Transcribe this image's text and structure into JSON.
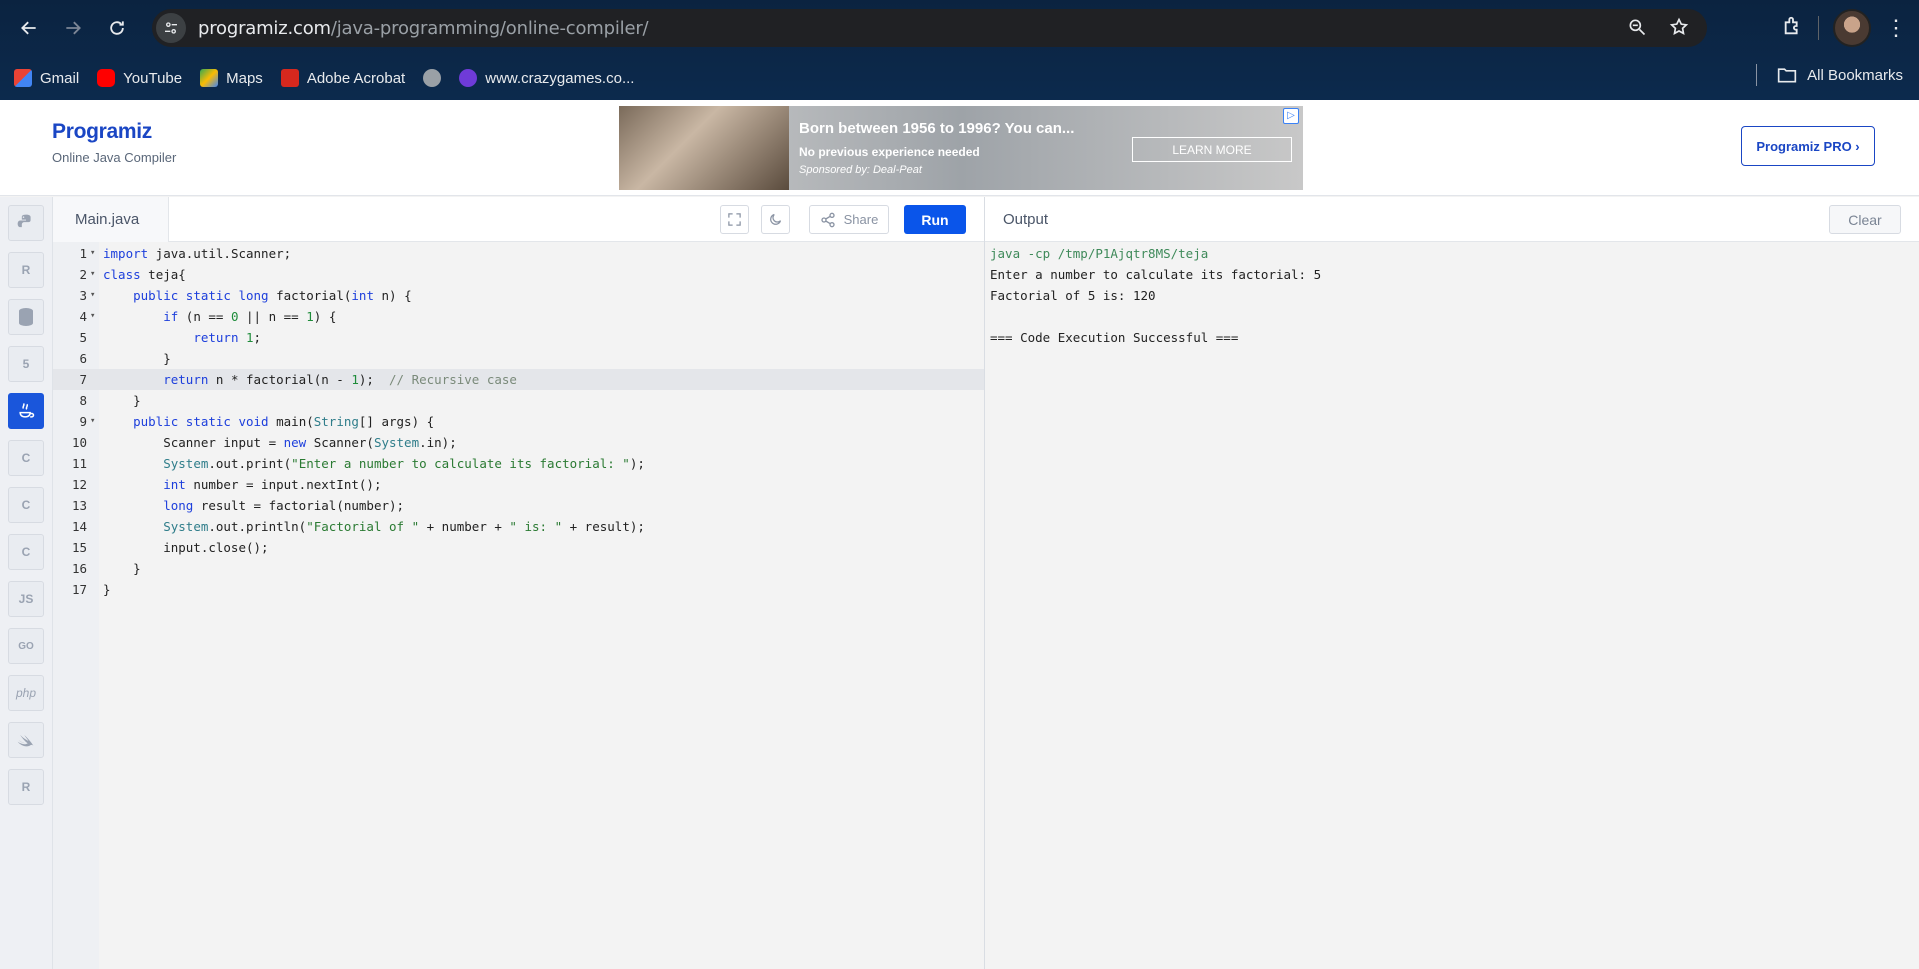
{
  "browser": {
    "url_host": "programiz.com",
    "url_path": "/java-programming/online-compiler/",
    "bookmarks": [
      "Gmail",
      "YouTube",
      "Maps",
      "Adobe Acrobat",
      "",
      "www.crazygames.co..."
    ],
    "all_bookmarks": "All Bookmarks"
  },
  "header": {
    "logo": "Programiz",
    "subtitle": "Online Java Compiler",
    "pro_button": "Programiz PRO ›"
  },
  "ad": {
    "title": "Born between 1956 to 1996? You can...",
    "line": "No previous experience needed",
    "sponsor": "Sponsored by: Deal-Peat",
    "button": "LEARN MORE"
  },
  "editor": {
    "file_tab": "Main.java",
    "share_label": "Share",
    "run_label": "Run",
    "active_line": 7
  },
  "languages": [
    "python",
    "r",
    "sql",
    "html",
    "java",
    "c",
    "cpp",
    "csharp",
    "JS",
    "GO",
    "php",
    "swift",
    "rust"
  ],
  "output": {
    "title": "Output",
    "clear_label": "Clear",
    "lines": [
      "java -cp /tmp/P1Ajqtr8MS/teja",
      "Enter a number to calculate its factorial: 5",
      "Factorial of 5 is: 120",
      "",
      "=== Code Execution Successful ==="
    ]
  }
}
